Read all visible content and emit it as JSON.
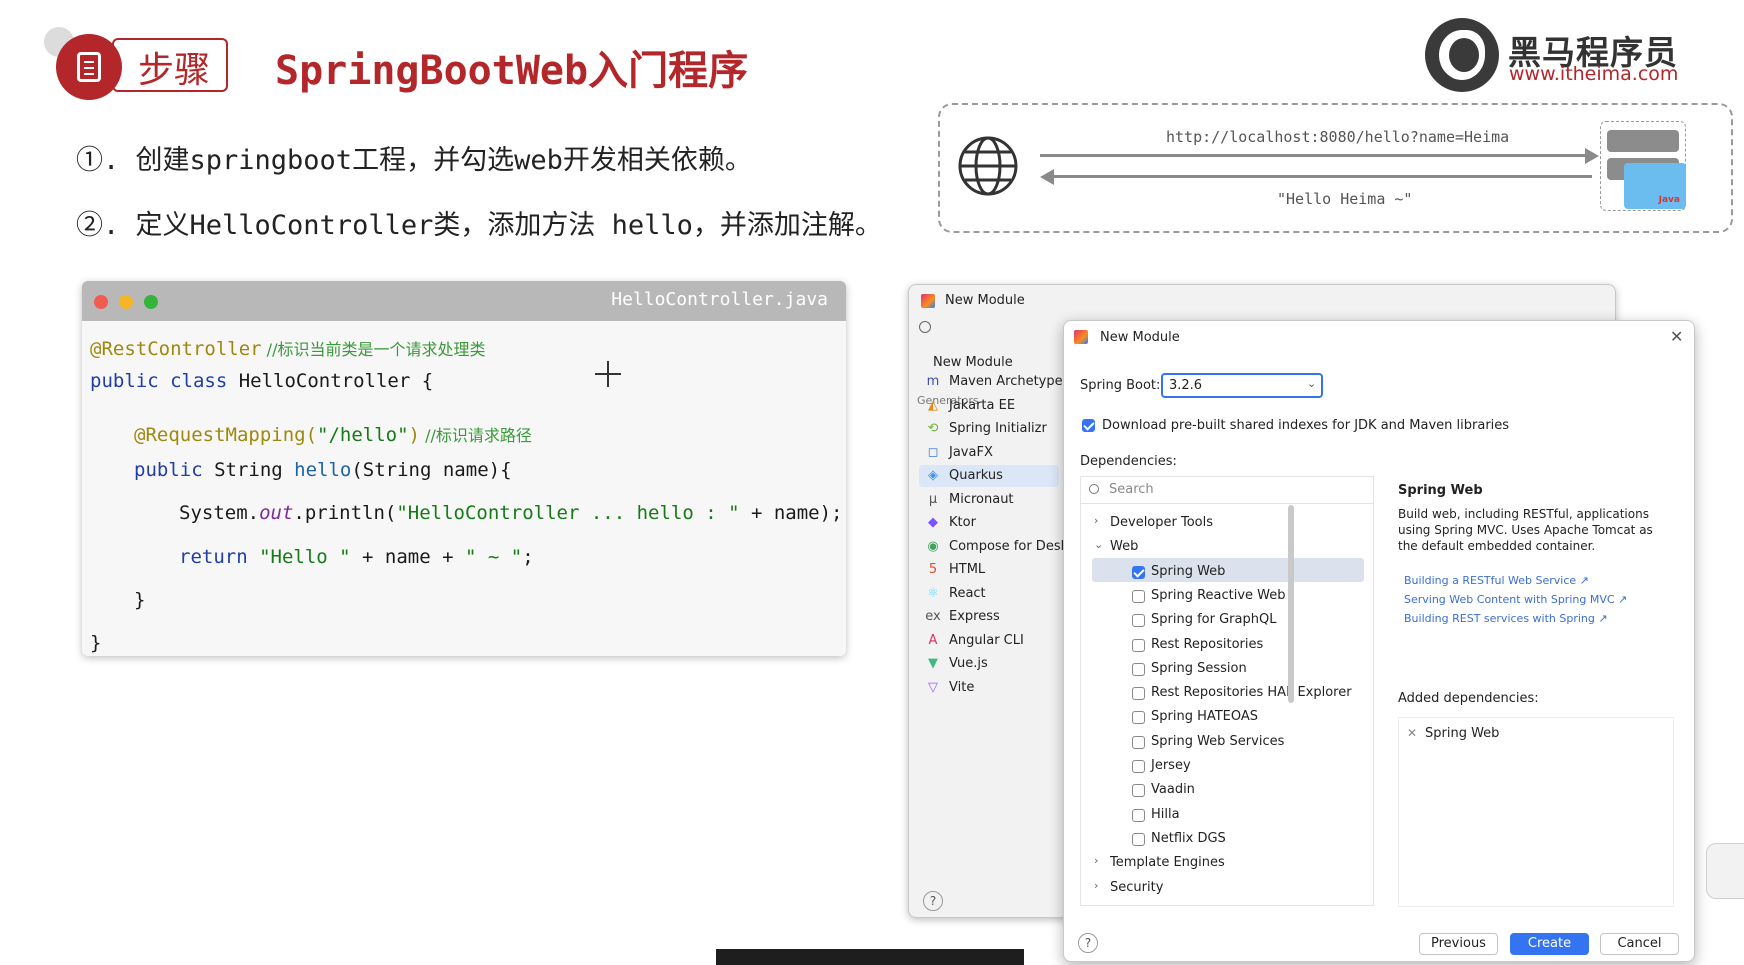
{
  "slide": {
    "badge": "步骤",
    "title": "SpringBootWeb入门程序",
    "logo": {
      "cn": "黑马程序员",
      "url": "www.itheima.com"
    },
    "steps": [
      "①. 创建springboot工程，并勾选web开发相关依赖。",
      "②. 定义HelloController类，添加方法 hello，并添加注解。"
    ]
  },
  "diagram": {
    "request_url": "http://localhost:8080/hello?name=Heima",
    "response_text": "\"Hello Heima ~\"",
    "server_badge": "Java",
    "icons": [
      "globe-icon",
      "server-icon",
      "java-folder-icon"
    ]
  },
  "code": {
    "filename": "HelloController.java",
    "l1_annotation": "@RestController",
    "l1_comment": " //标识当前类是一个请求处理类",
    "l2_kw": "public class",
    "l2_rest": " HelloController {",
    "l3_annotation": "@RequestMapping(",
    "l3_str": "\"/hello\"",
    "l3_close": ")",
    "l3_comment": " //标识请求路径",
    "l4_kw": "public",
    "l4_a": " String ",
    "l4_fn": "hello",
    "l4_b": "(String name){",
    "l5_a": "System.",
    "l5_out": "out",
    "l5_b": ".println(",
    "l5_str": "\"HelloController ... hello : \"",
    "l5_c": " + name);",
    "l6_kw": "return",
    "l6_s1": " \"Hello \"",
    "l6_mid": " + name + ",
    "l6_s2": "\" ~ \"",
    "l6_end": ";",
    "l7": "}",
    "l8": "}"
  },
  "ide_back": {
    "title": "New Module",
    "selected": "New Module",
    "generators_label": "Generators",
    "generators": [
      {
        "label": "Maven Archetype",
        "icon": "m"
      },
      {
        "label": "Jakarta EE",
        "icon": "jakarta"
      },
      {
        "label": "Spring Initializr",
        "icon": "spring"
      },
      {
        "label": "JavaFX",
        "icon": "javafx"
      },
      {
        "label": "Quarkus",
        "icon": "quarkus"
      },
      {
        "label": "Micronaut",
        "icon": "micronaut"
      },
      {
        "label": "Ktor",
        "icon": "ktor"
      },
      {
        "label": "Compose for Deskt",
        "icon": "compose"
      },
      {
        "label": "HTML",
        "icon": "html"
      },
      {
        "label": "React",
        "icon": "react"
      },
      {
        "label": "Express",
        "icon": "ex"
      },
      {
        "label": "Angular CLI",
        "icon": "angular"
      },
      {
        "label": "Vue.js",
        "icon": "vue"
      },
      {
        "label": "Vite",
        "icon": "vite"
      }
    ],
    "help": "?"
  },
  "dialog": {
    "title": "New Module",
    "spring_boot_label": "Spring Boot:",
    "spring_boot_value": "3.2.6",
    "download_label": "Download pre-built shared indexes for JDK and Maven libraries",
    "dependencies_label": "Dependencies:",
    "search_placeholder": "Search",
    "tree": [
      {
        "label": "Developer Tools",
        "type": "group",
        "expanded": false
      },
      {
        "label": "Web",
        "type": "group",
        "expanded": true
      },
      {
        "label": "Spring Web",
        "type": "item",
        "checked": true
      },
      {
        "label": "Spring Reactive Web",
        "type": "item",
        "checked": false
      },
      {
        "label": "Spring for GraphQL",
        "type": "item",
        "checked": false
      },
      {
        "label": "Rest Repositories",
        "type": "item",
        "checked": false
      },
      {
        "label": "Spring Session",
        "type": "item",
        "checked": false
      },
      {
        "label": "Rest Repositories HAL Explorer",
        "type": "item",
        "checked": false
      },
      {
        "label": "Spring HATEOAS",
        "type": "item",
        "checked": false
      },
      {
        "label": "Spring Web Services",
        "type": "item",
        "checked": false
      },
      {
        "label": "Jersey",
        "type": "item",
        "checked": false
      },
      {
        "label": "Vaadin",
        "type": "item",
        "checked": false
      },
      {
        "label": "Hilla",
        "type": "item",
        "checked": false
      },
      {
        "label": "Netflix DGS",
        "type": "item",
        "checked": false
      },
      {
        "label": "Template Engines",
        "type": "group",
        "expanded": false
      },
      {
        "label": "Security",
        "type": "group",
        "expanded": false
      }
    ],
    "detail_title": "Spring Web",
    "detail_desc_1": "Build web, including RESTful, applications",
    "detail_desc_2": "using Spring MVC. Uses Apache Tomcat as",
    "detail_desc_3": "the default embedded container.",
    "links": [
      "Building a RESTful Web Service ↗",
      "Serving Web Content with Spring MVC ↗",
      "Building REST services with Spring ↗"
    ],
    "added_label": "Added dependencies:",
    "added": [
      "Spring Web"
    ],
    "buttons": {
      "previous": "Previous",
      "create": "Create",
      "cancel": "Cancel"
    },
    "help": "?",
    "accent": "#3574f0"
  }
}
